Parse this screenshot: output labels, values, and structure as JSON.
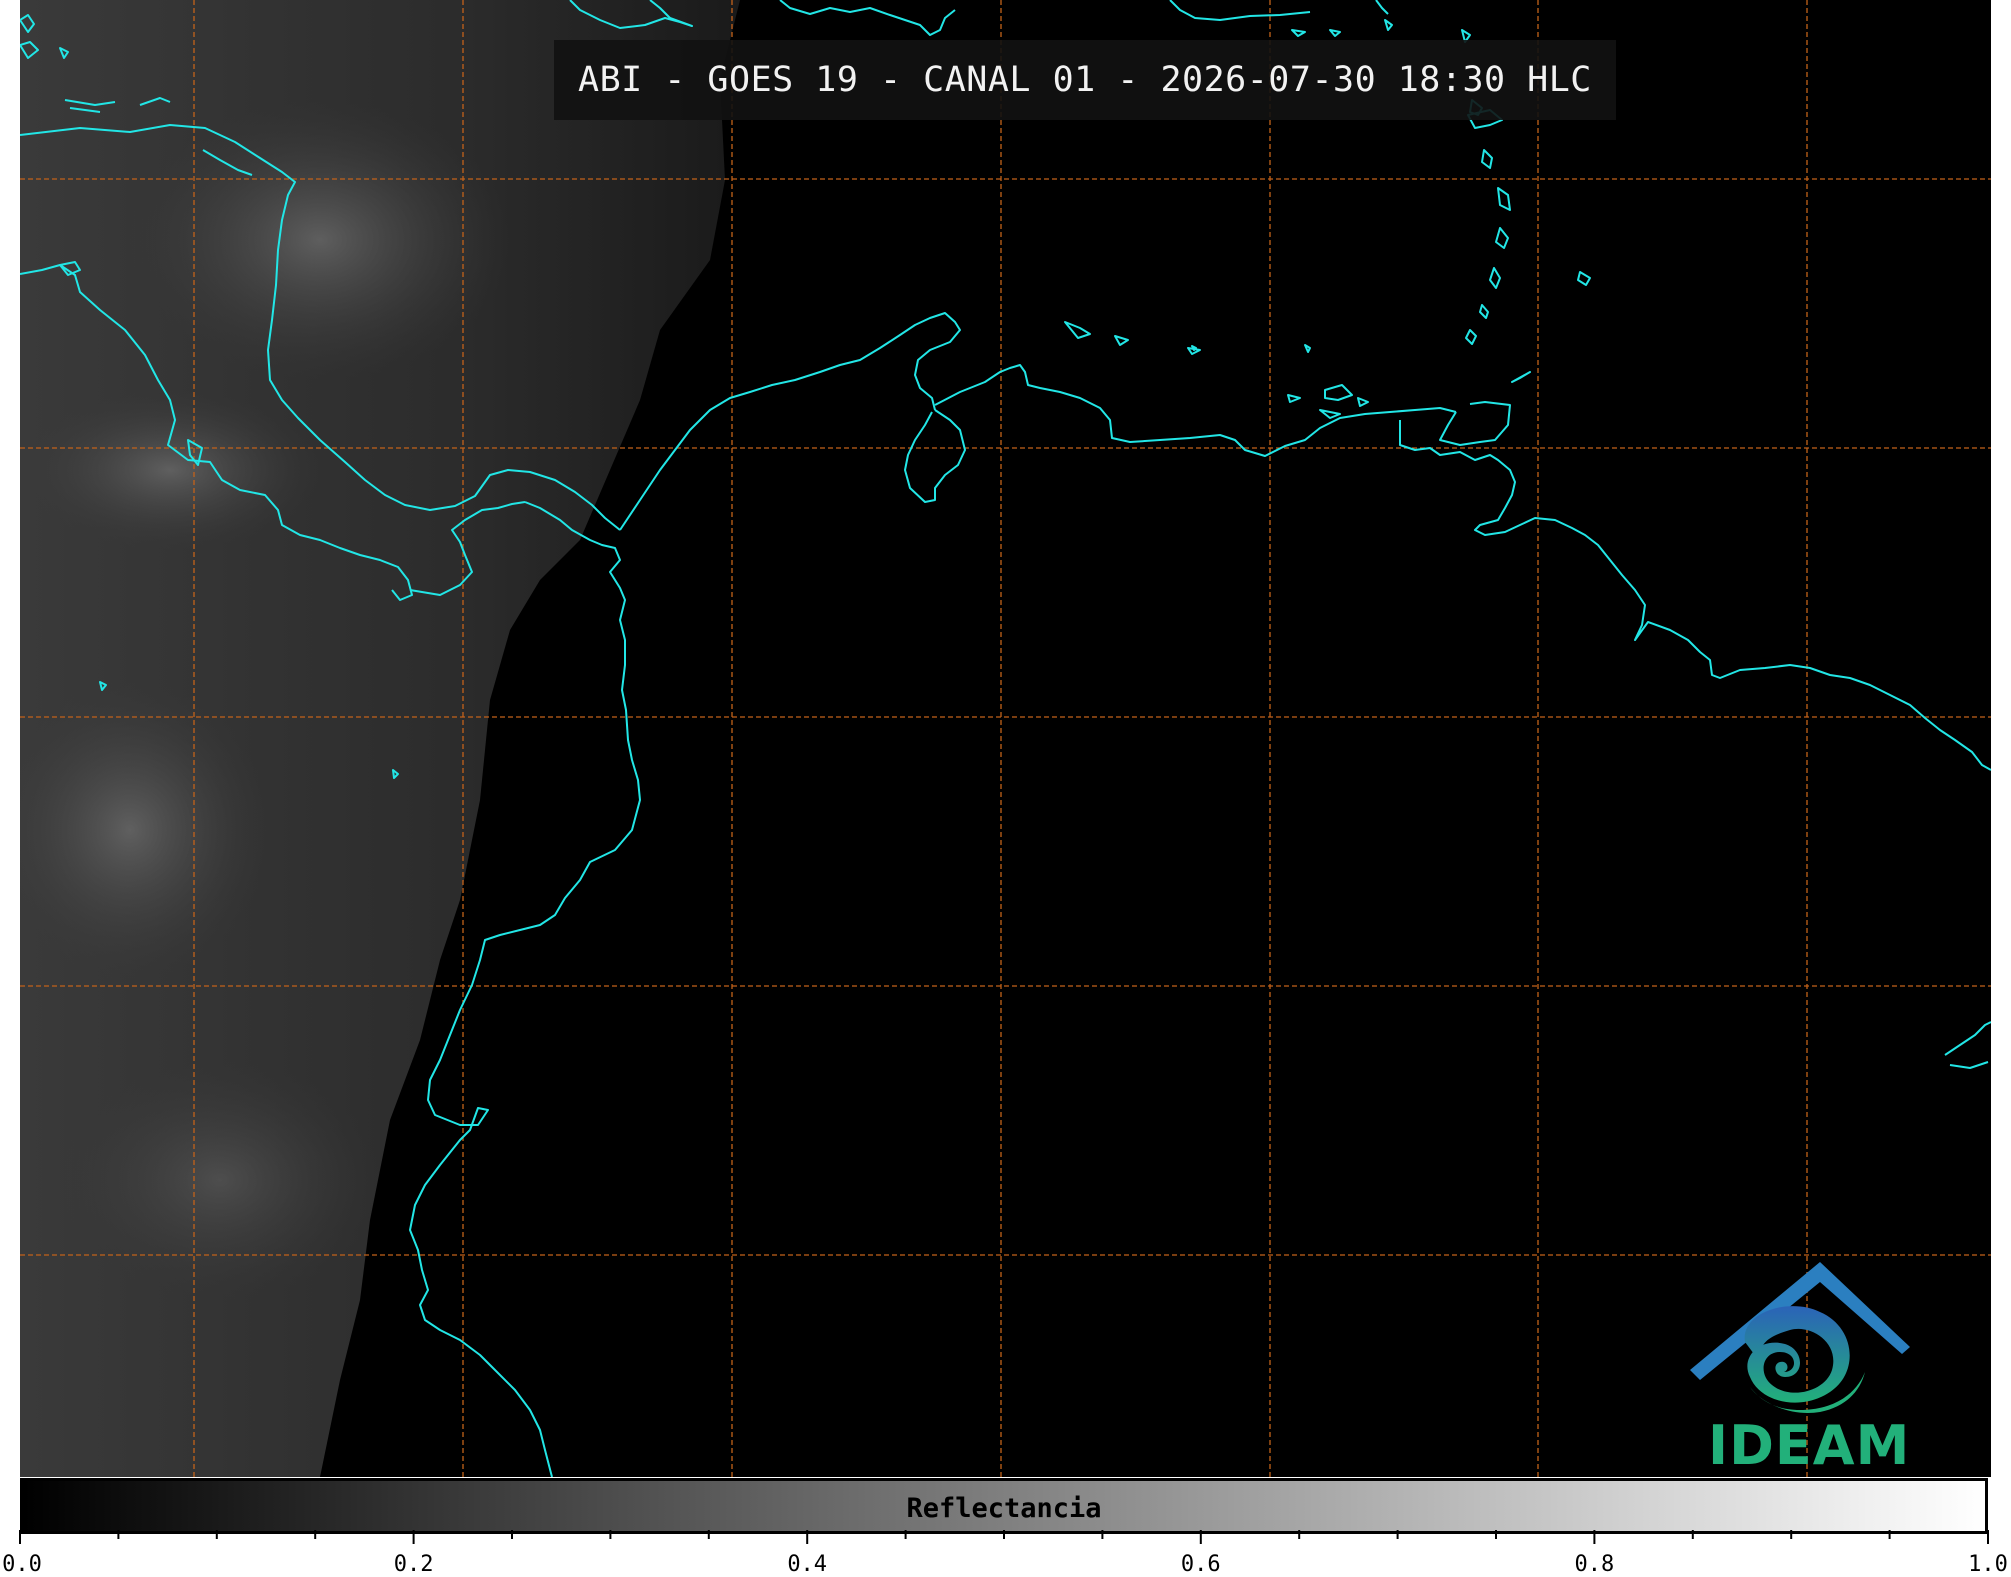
{
  "title": "ABI - GOES 19 - CANAL 01 - 2026-07-30 18:30 HLC",
  "logo_text": "IDEAM",
  "colorbar": {
    "label": "Reflectancia",
    "range": [
      0.0,
      1.0
    ],
    "colors": [
      "#000000",
      "#ffffff"
    ],
    "major_tick_labels": [
      "0.0",
      "0.2",
      "0.4",
      "0.6",
      "0.8",
      "1.0"
    ]
  },
  "style": {
    "coastline_color": "#22e6e6",
    "gridline_color": "#c2621a",
    "background": "#000000"
  }
}
